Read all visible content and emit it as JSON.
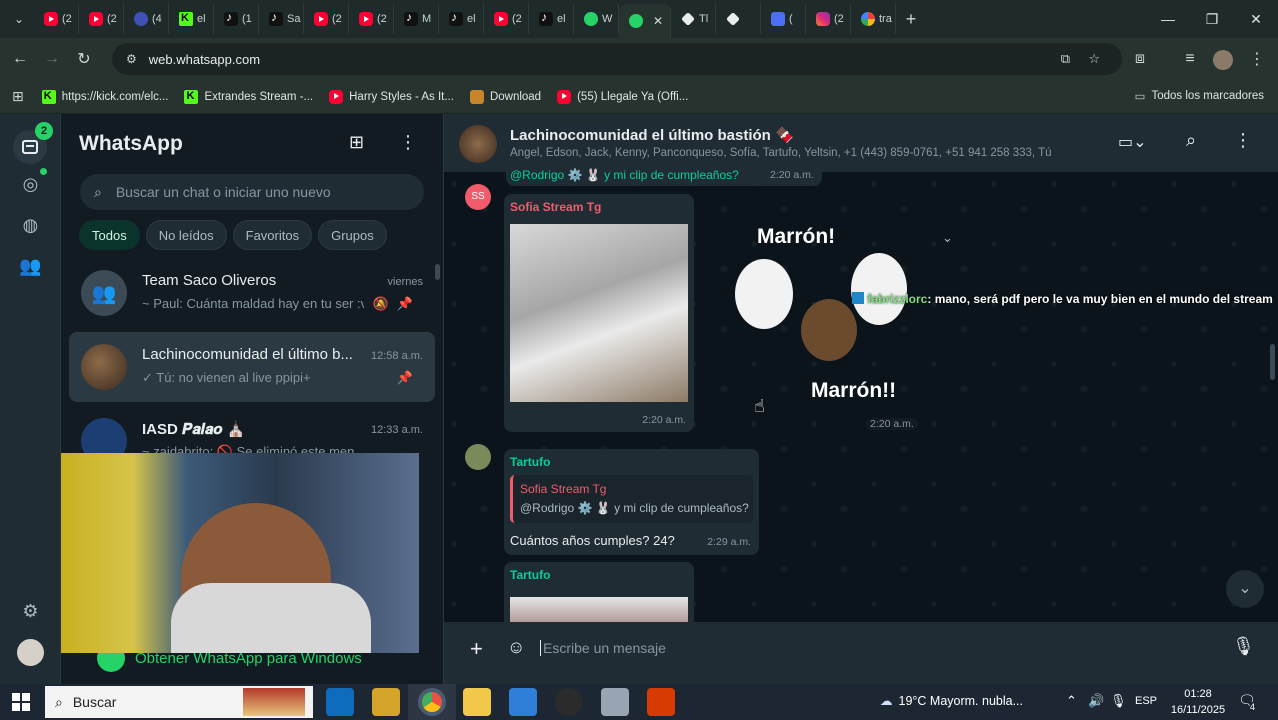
{
  "browser": {
    "tabs": [
      {
        "icon": "yt",
        "label": "(2"
      },
      {
        "icon": "yt",
        "label": "(2"
      },
      {
        "icon": "gen",
        "label": "(4"
      },
      {
        "icon": "kk",
        "label": "el"
      },
      {
        "icon": "tk",
        "label": "(1"
      },
      {
        "icon": "tk",
        "label": "Sa"
      },
      {
        "icon": "yt",
        "label": "(2"
      },
      {
        "icon": "yt",
        "label": "(2"
      },
      {
        "icon": "tk",
        "label": "M"
      },
      {
        "icon": "tk",
        "label": "el"
      },
      {
        "icon": "yt",
        "label": "(2"
      },
      {
        "icon": "tk",
        "label": "el"
      },
      {
        "icon": "wa",
        "label": "W"
      },
      {
        "icon": "wa",
        "label": "",
        "active": true
      },
      {
        "icon": "dia",
        "label": "Tl"
      },
      {
        "icon": "dia",
        "label": ""
      },
      {
        "icon": "blue",
        "label": "("
      },
      {
        "icon": "ig",
        "label": "(2"
      },
      {
        "icon": "go",
        "label": "tra"
      }
    ],
    "new_tab": "+",
    "url": "web.whatsapp.com",
    "bookmarks": [
      {
        "icon": "kk",
        "label": "https://kick.com/elc..."
      },
      {
        "icon": "kk",
        "label": "Extrandes Stream -..."
      },
      {
        "icon": "yt",
        "label": "Harry Styles - As It..."
      },
      {
        "icon": "r",
        "label": "Download"
      },
      {
        "icon": "yt",
        "label": "(55) Llegale Ya (Offi..."
      }
    ],
    "all_bookmarks": "Todos los marcadores"
  },
  "whatsapp": {
    "rail_badge": "2",
    "title": "WhatsApp",
    "search_placeholder": "Buscar un chat o iniciar uno nuevo",
    "filters": [
      "Todos",
      "No leídos",
      "Favoritos",
      "Grupos"
    ],
    "chats": [
      {
        "name": "Team Saco Oliveros",
        "time": "viernes",
        "preview": "~ Paul: Cuánta maldad hay en tu ser :v"
      },
      {
        "name": "Lachinocomunidad el último b...",
        "time": "12:58 a.m.",
        "preview": "✓ Tú: no vienen al live ppipi+"
      },
      {
        "name": "IASD 𝑷𝒂𝒍𝒂𝒐 ⛪",
        "time": "12:33 a.m.",
        "preview": "~ zaidabrito: 🚫 Se eliminó este men..."
      }
    ],
    "get_app": "Obtener WhatsApp para Windows",
    "chat": {
      "title": "Lachinocomunidad el último bastión 🍫",
      "members": "Angel, Edson, Jack, Kenny, Panconqueso, Sofía, Tartufo, Yeltsin, +1 (443) 859-0761, +51 941 258 333, Tú",
      "top_snippet": "@Rodrigo ⚙️ 🐰 y mi clip de cumpleaños?",
      "top_time": "2:20 a.m.",
      "msg1_avatar": "SS",
      "msg1_sender": "Sofia Stream Tg",
      "msg1_img_time": "2:20 a.m.",
      "sticker_top": "Marrón!",
      "sticker_bottom": "Marrón!!",
      "sticker_time": "2:20 a.m.",
      "overlay_user": "fabrizzlorc",
      "overlay_text": ": mano, será pdf pero le va muy bien en el mundo del stream",
      "msg2_sender": "Tartufo",
      "msg2_quote_sender": "Sofia Stream Tg",
      "msg2_quote_text": "@Rodrigo ⚙️ 🐰 y mi clip de cumpleaños?",
      "msg2_text": "Cuántos años cumples? 24?",
      "msg2_time": "2:29 a.m.",
      "msg3_sender": "Tartufo",
      "composer_placeholder": "Escribe un mensaje"
    }
  },
  "taskbar": {
    "search": "Buscar",
    "weather": "19°C  Mayorm. nubla...",
    "lang": "ESP",
    "time": "01:28",
    "date": "16/11/2025",
    "notif_count": "4"
  },
  "colors": {
    "accent": "#25d366",
    "sender_red": "#f15c6d",
    "sender_green": "#53bdeb",
    "tartufo": "#06cf9c"
  }
}
